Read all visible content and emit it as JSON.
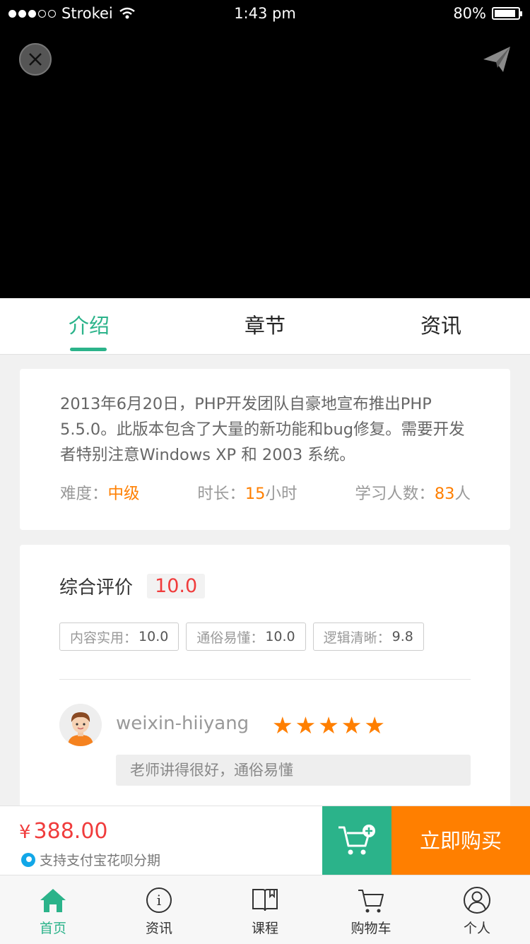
{
  "status_bar": {
    "carrier": "Strokei",
    "time": "1:43 pm",
    "battery": "80%"
  },
  "tabs": [
    {
      "label": "介绍",
      "active": true
    },
    {
      "label": "章节",
      "active": false
    },
    {
      "label": "资讯",
      "active": false
    }
  ],
  "intro": {
    "text": "2013年6月20日，PHP开发团队自豪地宣布推出PHP 5.5.0。此版本包含了大量的新功能和bug修复。需要开发者特别注意Windows XP 和 2003 系统。",
    "difficulty_label": "难度：",
    "difficulty_value": "中级",
    "duration_label": "时长：",
    "duration_value": "15",
    "duration_unit": "小时",
    "students_label": "学习人数：",
    "students_value": "83",
    "students_unit": "人"
  },
  "review": {
    "rating_label": "综合评价",
    "rating_score": "10.0",
    "tags": [
      {
        "label": "内容实用：",
        "value": "10.0"
      },
      {
        "label": "通俗易懂：",
        "value": "10.0"
      },
      {
        "label": "逻辑清晰：",
        "value": "9.8"
      }
    ],
    "comment_user": "weixin-hiiyang",
    "comment_stars": 5,
    "comment_text": "老师讲得很好，通俗易懂"
  },
  "purchase": {
    "currency": "¥",
    "price": "388.00",
    "alipay_note": "支持支付宝花呗分期",
    "buy_label": "立即购买"
  },
  "nav": [
    {
      "label": "首页",
      "icon": "home-icon",
      "active": true
    },
    {
      "label": "资讯",
      "icon": "info-icon",
      "active": false
    },
    {
      "label": "课程",
      "icon": "book-icon",
      "active": false
    },
    {
      "label": "购物车",
      "icon": "cart-icon",
      "active": false
    },
    {
      "label": "个人",
      "icon": "user-icon",
      "active": false
    }
  ],
  "colors": {
    "accent": "#2bb38a",
    "orange": "#ff7f00",
    "price_red": "#f03c3c"
  }
}
